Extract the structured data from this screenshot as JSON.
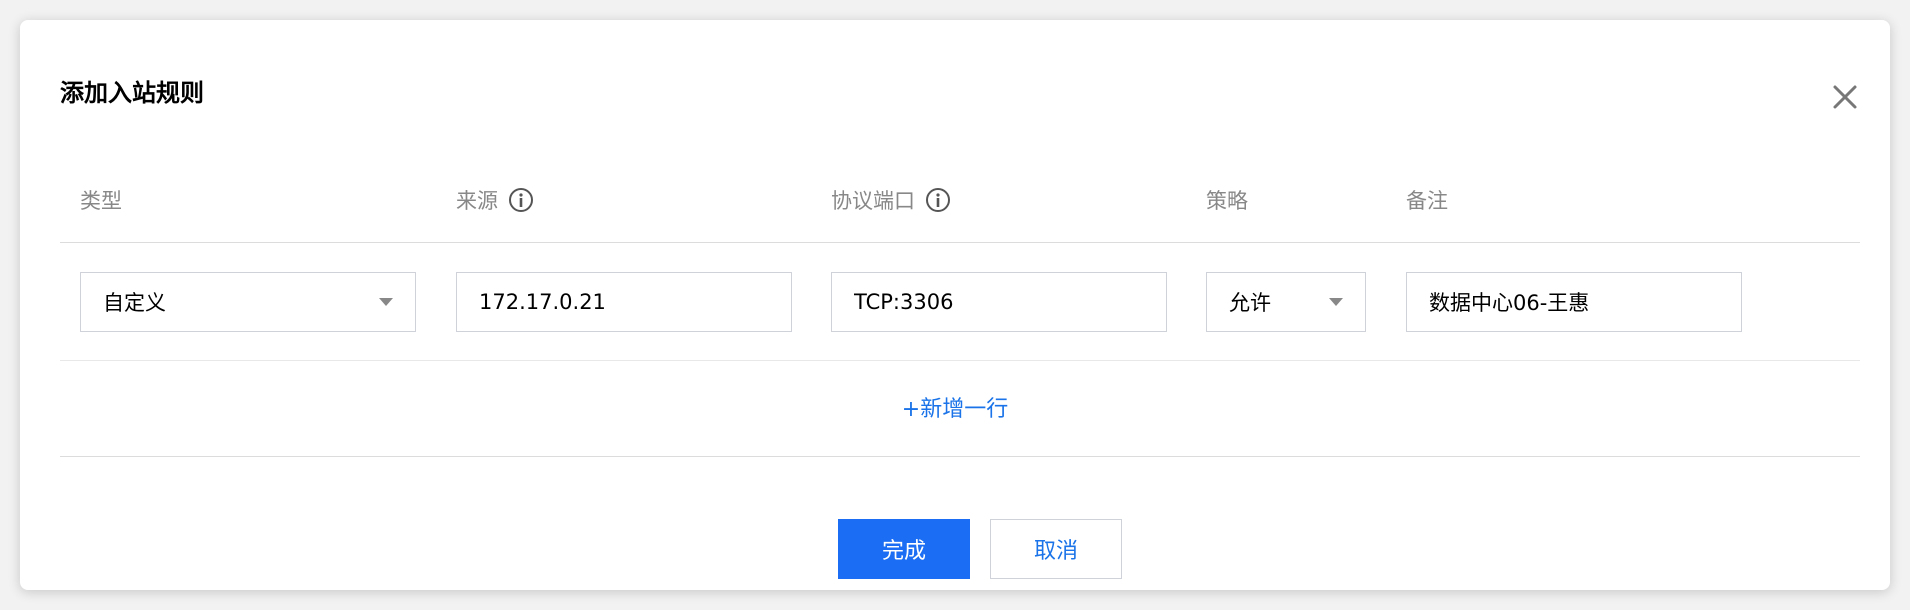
{
  "dialog": {
    "title": "添加入站规则",
    "close_icon": "close-icon"
  },
  "table": {
    "headers": [
      {
        "label": "类型",
        "has_info": false
      },
      {
        "label": "来源",
        "has_info": true
      },
      {
        "label": "协议端口",
        "has_info": true
      },
      {
        "label": "策略",
        "has_info": false
      },
      {
        "label": "备注",
        "has_info": false
      }
    ],
    "rows": [
      {
        "type": "自定义",
        "source": "172.17.0.21",
        "port": "TCP:3306",
        "policy": "允许",
        "remark": "数据中心06-王惠"
      }
    ]
  },
  "add_row_label": "+新增一行",
  "buttons": {
    "confirm_label": "完成",
    "cancel_label": "取消"
  },
  "colors": {
    "primary": "#1b6ef3",
    "link": "#1a73e8",
    "header_text": "#888888",
    "border": "#cfd2d8"
  }
}
